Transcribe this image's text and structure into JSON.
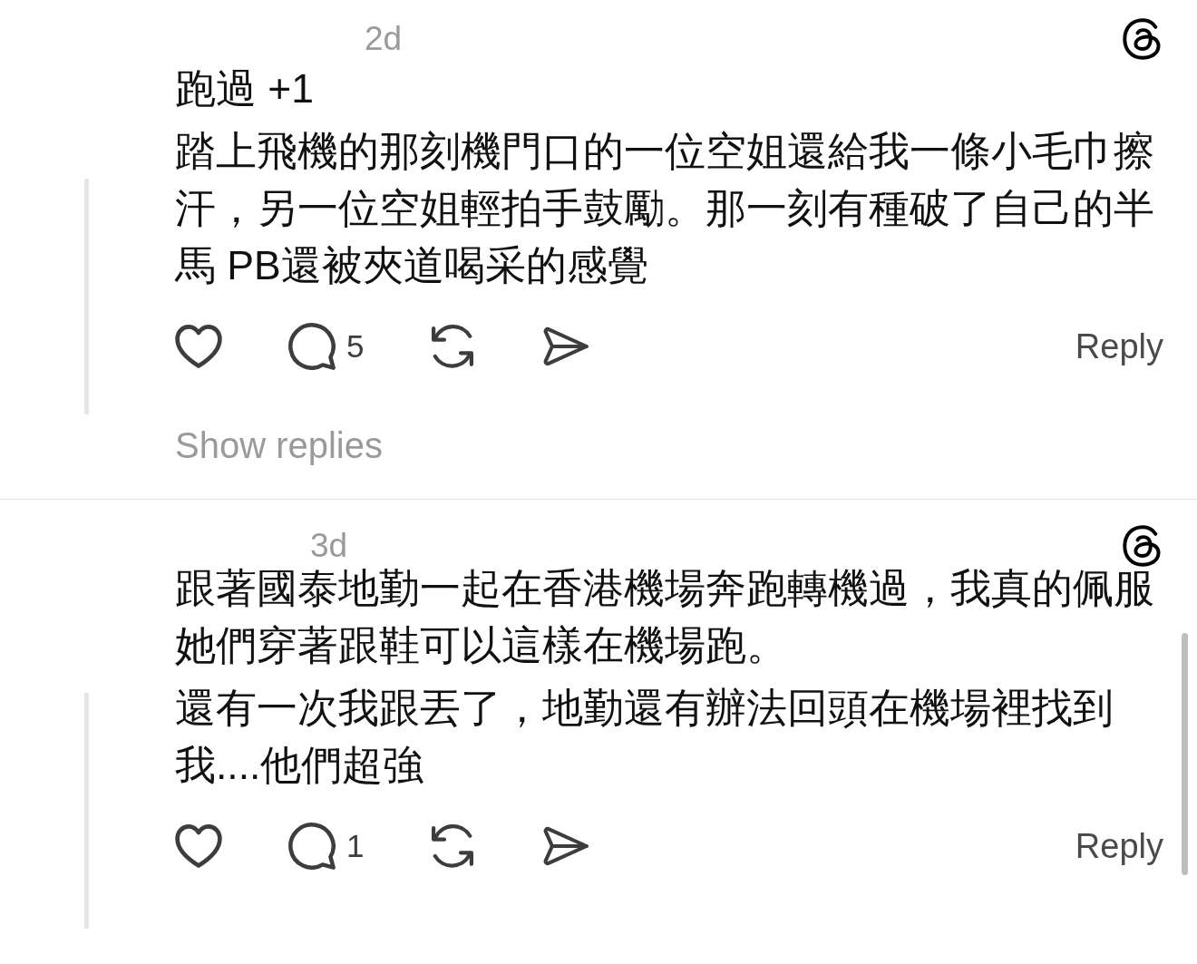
{
  "posts": [
    {
      "time": "2d",
      "paragraphs": [
        "跑過 +1",
        "踏上飛機的那刻機門口的一位空姐還給我一條小毛巾擦汗，另一位空姐輕拍手鼓勵。那一刻有種破了自己的半馬 PB還被夾道喝采的感覺"
      ],
      "reply_count": "5",
      "reply_label": "Reply",
      "show_replies": "Show replies"
    },
    {
      "time": "3d",
      "paragraphs": [
        "跟著國泰地勤一起在香港機場奔跑轉機過，我真的佩服她們穿著跟鞋可以這樣在機場跑。",
        "還有一次我跟丟了，地勤還有辦法回頭在機場裡找到我....他們超強"
      ],
      "reply_count": "1",
      "reply_label": "Reply"
    }
  ]
}
